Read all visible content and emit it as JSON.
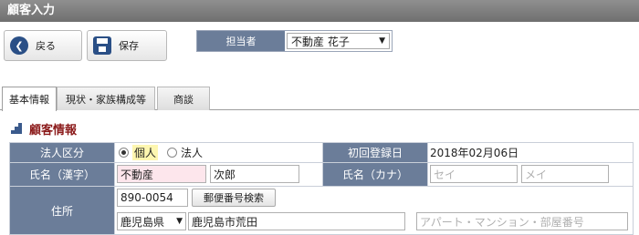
{
  "window": {
    "title": "顧客入力"
  },
  "toolbar": {
    "back_label": "戻る",
    "save_label": "保存",
    "assignee_label": "担当者",
    "assignee_value": "不動産 花子"
  },
  "tabs": [
    {
      "label": "基本情報",
      "active": true
    },
    {
      "label": "現状・家族構成等",
      "active": false
    },
    {
      "label": "商談",
      "active": false
    }
  ],
  "section": {
    "title": "顧客情報"
  },
  "form": {
    "corp_type_label": "法人区分",
    "corp_type_options": [
      "個人",
      "法人"
    ],
    "corp_type_selected": "個人",
    "first_reg_label": "初回登録日",
    "first_reg_value": "2018年02月06日",
    "name_kanji_label": "氏名（漢字）",
    "last_name_kanji": "不動産",
    "first_name_kanji": "次郎",
    "name_kana_label": "氏名（カナ）",
    "last_name_kana_placeholder": "セイ",
    "first_name_kana_placeholder": "メイ",
    "address_label": "住所",
    "postal_code": "890-0054",
    "postal_search_label": "郵便番号検索",
    "prefecture": "鹿児島県",
    "city": "鹿児島市荒田",
    "building_placeholder": "アパート・マンション・部屋番号"
  },
  "colors": {
    "header_bg": "#6b7d99",
    "title_bar": "#7f7f7f",
    "section_title": "#8b1a1a",
    "required_field": "#fde6ec"
  }
}
